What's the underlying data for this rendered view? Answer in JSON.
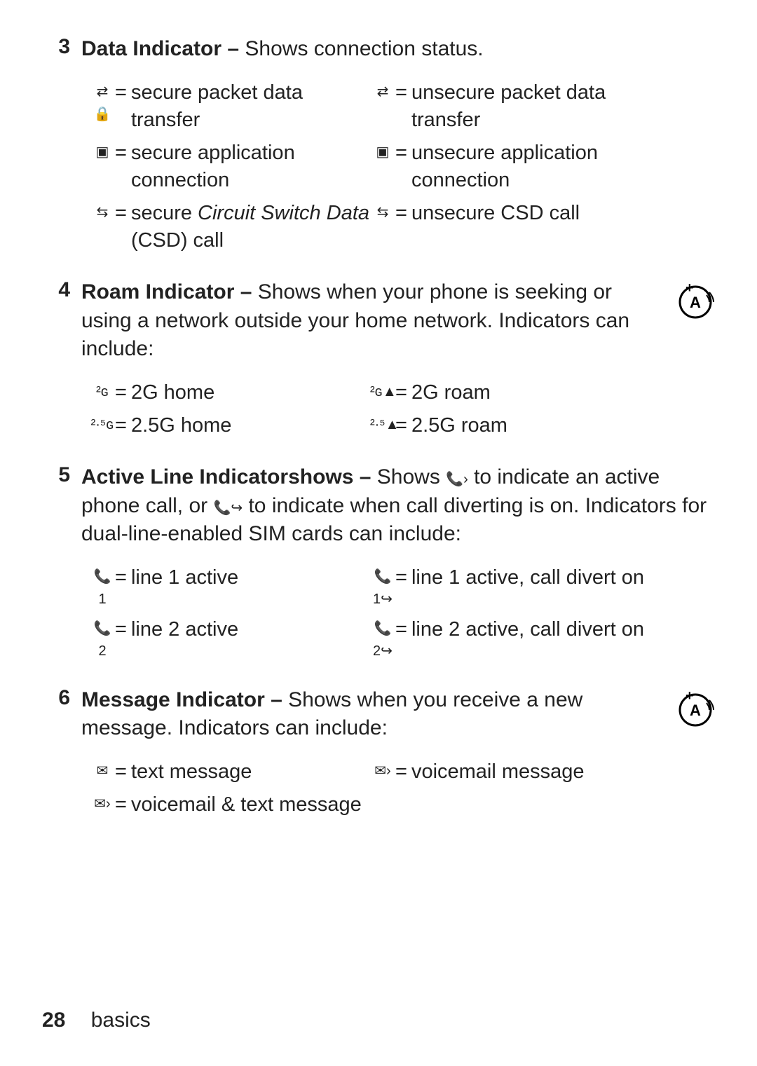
{
  "sections": {
    "s3": {
      "num": "3",
      "heading": "Data Indicator – ",
      "desc": "Shows connection status.",
      "rows": [
        {
          "l_sym": "⇄🔒",
          "l_txt": "secure packet data transfer",
          "r_sym": "⇄",
          "r_txt": "unsecure packet data transfer"
        },
        {
          "l_sym": "▣",
          "l_txt": "secure application connection",
          "r_sym": "▣",
          "r_txt": "unsecure application connection"
        },
        {
          "l_sym": "⇆",
          "l_txt_html": "secure <em class='it'>Circuit Switch Data</em> (CSD) call",
          "r_sym": "⇆",
          "r_txt": "unsecure CSD call"
        }
      ]
    },
    "s4": {
      "num": "4",
      "heading": "Roam Indicator – ",
      "desc": "Shows when your phone is seeking or using a network outside your home network. Indicators can include:",
      "badge": true,
      "rows": [
        {
          "l_sym": "²ɢ",
          "l_txt": "2G home",
          "r_sym": "²ɢ▲",
          "r_txt": "2G roam"
        },
        {
          "l_sym": "²·⁵ɢ",
          "l_txt": "2.5G home",
          "r_sym": "²·⁵▲",
          "r_txt": "2.5G roam"
        }
      ]
    },
    "s5": {
      "num": "5",
      "heading": "Active Line Indicatorshows – ",
      "desc_pre": "Shows ",
      "inline_icon1": "📞›",
      "desc_mid": " to indicate an active phone call, or ",
      "inline_icon2": "📞↪",
      "desc_post": " to indicate when call diverting is on. Indicators for dual-line-enabled SIM cards can include:",
      "rows": [
        {
          "l_sym": "📞1",
          "l_txt": "line 1 active",
          "r_sym": "📞1↪",
          "r_txt": "line 1 active, call divert on"
        },
        {
          "l_sym": "📞2",
          "l_txt": "line 2 active",
          "r_sym": "📞2↪",
          "r_txt": "line 2 active, call divert on"
        }
      ]
    },
    "s6": {
      "num": "6",
      "heading": "Message Indicator – ",
      "desc": "Shows when you receive a new message. Indicators can include:",
      "badge": true,
      "rows": [
        {
          "l_sym": "✉",
          "l_txt": "text message",
          "r_sym": "✉›",
          "r_txt": "voicemail message"
        },
        {
          "l_sym": "✉›",
          "l_txt": "voicemail & text message",
          "r_sym": "",
          "r_txt": ""
        }
      ]
    }
  },
  "footer": {
    "page": "28",
    "section": "basics"
  },
  "equals": "="
}
